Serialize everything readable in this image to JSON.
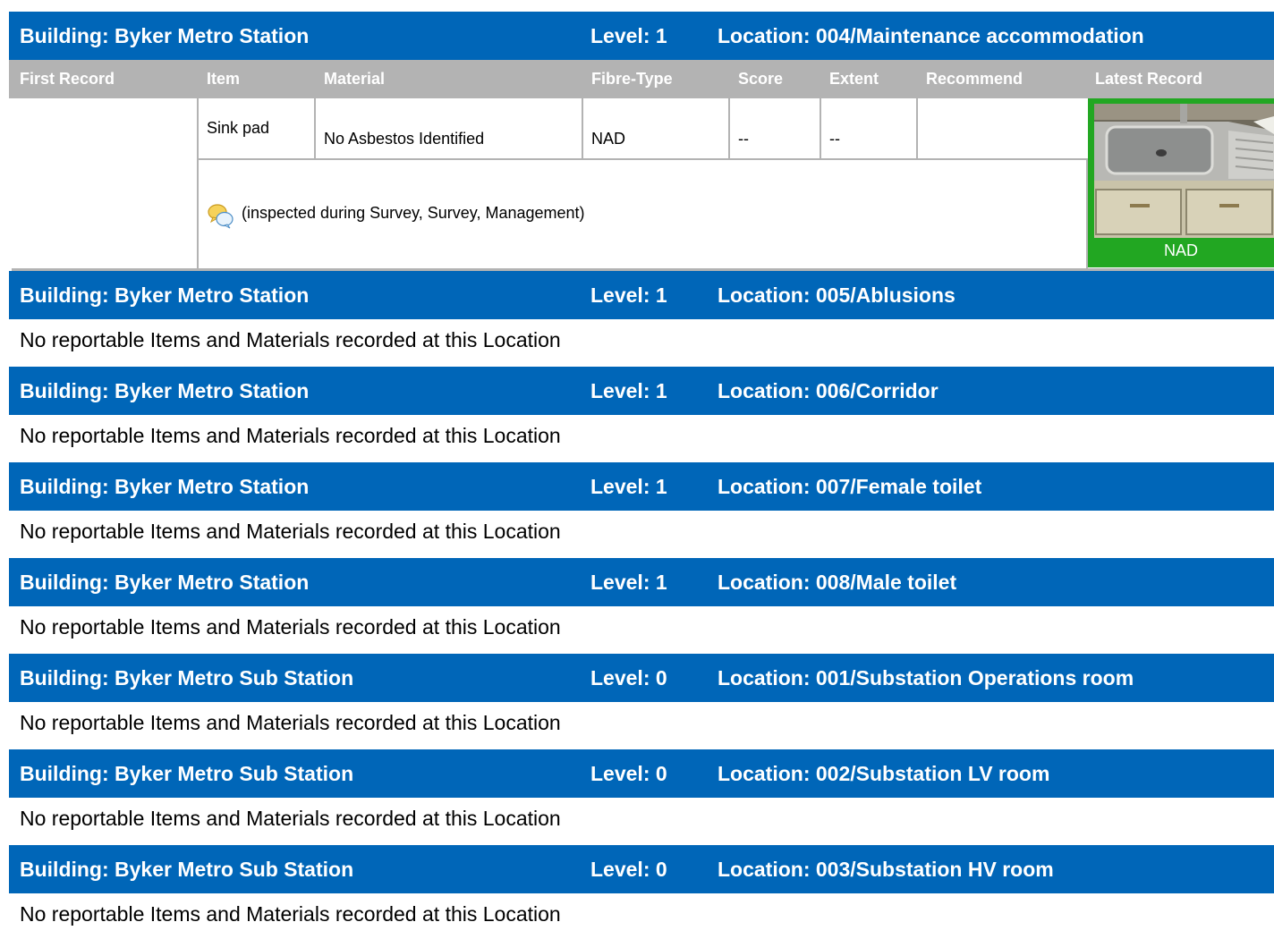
{
  "columns": [
    "First Record",
    "Item",
    "Material",
    "Fibre-Type",
    "Score",
    "Extent",
    "Recommend",
    "Latest Record"
  ],
  "record": {
    "first_record": "",
    "item": "Sink pad",
    "material": "No Asbestos Identified",
    "fibre_type": "NAD",
    "score": "--",
    "extent": "--",
    "recommend": "",
    "notes": "(inspected during Survey, Survey, Management)",
    "photo_label": "NAD",
    "photo_icon": "sink-photo"
  },
  "locations": [
    {
      "building": "Building: Byker Metro Station",
      "level": "Level: 1",
      "location": "Location: 004/Maintenance accommodation",
      "empty_text": ""
    },
    {
      "building": "Building: Byker Metro Station",
      "level": "Level: 1",
      "location": "Location: 005/Ablusions",
      "empty_text": "No reportable Items and Materials recorded at this Location"
    },
    {
      "building": "Building: Byker Metro Station",
      "level": "Level: 1",
      "location": "Location: 006/Corridor",
      "empty_text": "No reportable Items and Materials recorded at this Location"
    },
    {
      "building": "Building: Byker Metro Station",
      "level": "Level: 1",
      "location": "Location: 007/Female toilet",
      "empty_text": "No reportable Items and Materials recorded at this Location"
    },
    {
      "building": "Building: Byker Metro Station",
      "level": "Level: 1",
      "location": "Location: 008/Male toilet",
      "empty_text": "No reportable Items and Materials recorded at this Location"
    },
    {
      "building": "Building: Byker Metro Sub Station",
      "level": "Level: 0",
      "location": "Location: 001/Substation Operations room",
      "empty_text": "No reportable Items and Materials recorded at this Location"
    },
    {
      "building": "Building: Byker Metro Sub Station",
      "level": "Level: 0",
      "location": "Location: 002/Substation LV room",
      "empty_text": "No reportable Items and Materials recorded at this Location"
    },
    {
      "building": "Building: Byker Metro Sub Station",
      "level": "Level: 0",
      "location": "Location: 003/Substation HV room",
      "empty_text": "No reportable Items and Materials recorded at this Location"
    }
  ],
  "colors": {
    "header_blue": "#0066b8",
    "column_grey": "#b3b3b3",
    "nad_green": "#22a722"
  }
}
